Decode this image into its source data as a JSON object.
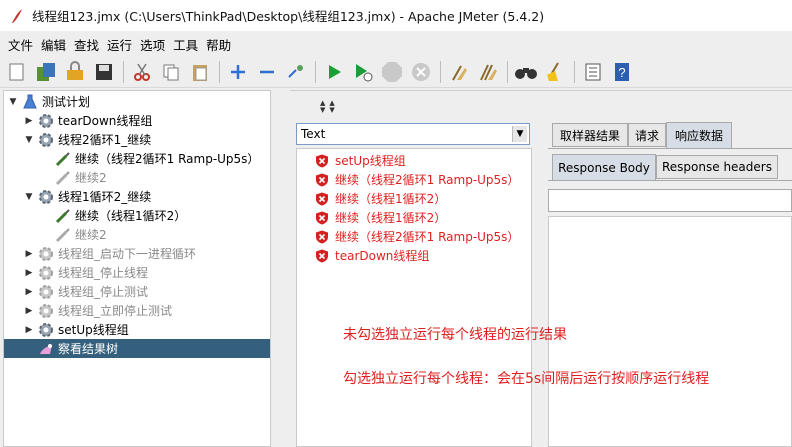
{
  "window": {
    "title": "线程组123.jmx (C:\\Users\\ThinkPad\\Desktop\\线程组123.jmx) - Apache JMeter (5.4.2)"
  },
  "menu": [
    "文件",
    "编辑",
    "查找",
    "运行",
    "选项",
    "工具",
    "帮助"
  ],
  "toolbar_icons": [
    "new-icon",
    "templates-icon",
    "open-icon",
    "save-icon",
    "cut-icon",
    "copy-icon",
    "paste-icon",
    "expand-icon",
    "collapse-icon",
    "toggle-icon",
    "start-icon",
    "start-no-pause-icon",
    "stop-icon",
    "shutdown-icon",
    "clear-icon",
    "clear-all-icon",
    "search-icon",
    "reset-search-icon",
    "function-helper-icon",
    "help-icon"
  ],
  "tree": {
    "root": "测试计划",
    "items": [
      {
        "label": "tearDown线程组"
      },
      {
        "label": "线程2循环1_继续"
      },
      {
        "label": "继续（线程2循环1 Ramp-Up5s）"
      },
      {
        "label": "继续2"
      },
      {
        "label": "线程1循环2_继续"
      },
      {
        "label": "继续（线程1循环2）"
      },
      {
        "label": "继续2"
      },
      {
        "label": "线程组_启动下一进程循环"
      },
      {
        "label": "线程组_停止线程"
      },
      {
        "label": "线程组_停止测试"
      },
      {
        "label": "线程组_立即停止测试"
      },
      {
        "label": "setUp线程组"
      },
      {
        "label": "察看结果树"
      }
    ]
  },
  "renderer": {
    "selected": "Text"
  },
  "results": [
    "setUp线程组",
    "继续（线程2循环1 Ramp-Up5s）",
    "继续（线程1循环2）",
    "继续（线程1循环2）",
    "继续（线程2循环1 Ramp-Up5s）",
    "tearDown线程组"
  ],
  "notes": [
    "未勾选独立运行每个线程的运行结果",
    "勾选独立运行每个线程：会在5s间隔后运行按顺序运行线程"
  ],
  "tabs": {
    "sampler": "取样器结果",
    "request": "请求",
    "response": "响应数据"
  },
  "subtabs": {
    "body": "Response Body",
    "headers": "Response headers"
  },
  "colors": {
    "selection": "#35607d",
    "result_text": "#e02020"
  }
}
